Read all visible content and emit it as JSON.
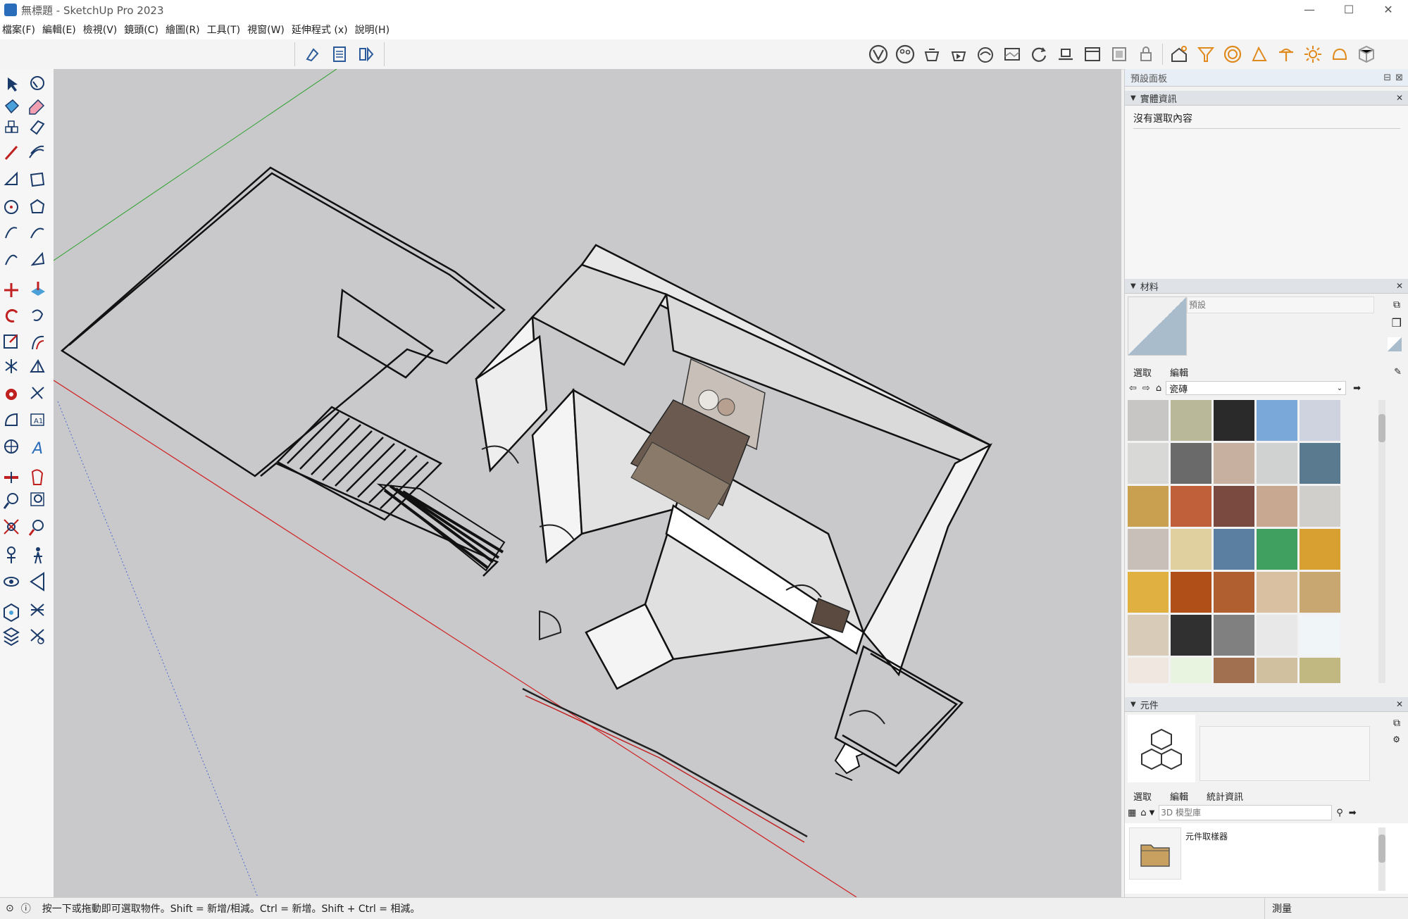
{
  "window": {
    "title": "無標題 - SketchUp Pro 2023",
    "min": "—",
    "max": "☐",
    "close": "✕"
  },
  "menu": [
    "檔案(F)",
    "編輯(E)",
    "檢視(V)",
    "鏡頭(C)",
    "繪圖(R)",
    "工具(T)",
    "視窗(W)",
    "延伸程式 (x)",
    "說明(H)"
  ],
  "tray": {
    "title": "預設面板",
    "entity_info": {
      "header": "實體資訊",
      "empty_text": "沒有選取內容"
    },
    "materials": {
      "header": "材料",
      "name_placeholder": "預設",
      "tabs": [
        "選取",
        "編輯"
      ],
      "library": "瓷磚",
      "swatch_colors": [
        [
          "#c8c6c4",
          "#b9b99a",
          "#2a2a2a",
          "#7aa8d8",
          "#cfd3e0"
        ],
        [
          "#d8d8d6",
          "#6a6a6a",
          "#c8b0a0",
          "#cfd2d0",
          "#5a7a90"
        ],
        [
          "#c8a050",
          "#c0603a",
          "#7a4a40",
          "#c8a890",
          "#d0cfcc"
        ],
        [
          "#c8c0b8",
          "#e0d0a0",
          "#5a7fa0",
          "#40a060",
          "#d8a030"
        ],
        [
          "#e0b040",
          "#b05018",
          "#b06030",
          "#d8c0a0",
          "#c8a870"
        ],
        [
          "#d8ccb8",
          "#303030",
          "#808080",
          "#e8e8e8",
          "#f0f6f8"
        ],
        [
          "#f0e8e0",
          "#e8f4e0",
          "#a07050",
          "#d0c0a0",
          "#c0b880"
        ]
      ]
    },
    "components": {
      "header": "元件",
      "tabs": [
        "選取",
        "編輯",
        "統計資訊"
      ],
      "search_placeholder": "3D 模型庫",
      "item_label": "元件取樣器"
    }
  },
  "status": {
    "message": "按一下或拖動即可選取物件。Shift = 新增/相減。Ctrl = 新增。Shift + Ctrl = 相減。",
    "measure_label": "測量"
  }
}
